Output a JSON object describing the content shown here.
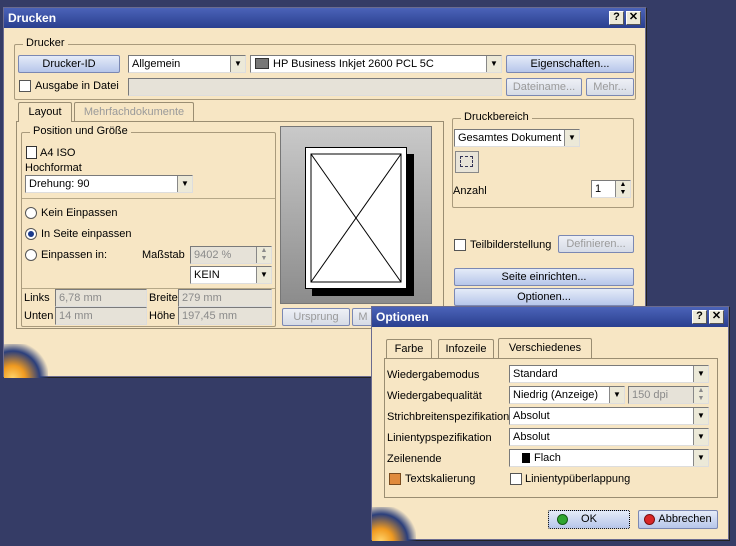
{
  "drucken": {
    "title": "Drucken",
    "help": "?",
    "close": "✕",
    "drucker_group": "Drucker",
    "drucker_id_btn": "Drucker-ID",
    "category": "Allgemein",
    "printer": "HP Business Inkjet 2600 PCL 5C",
    "eigenschaften_btn": "Eigenschaften...",
    "ausgabe_label": "Ausgabe in Datei",
    "dateiname_btn": "Dateiname...",
    "mehr_btn": "Mehr...",
    "tabs": [
      "Layout",
      "Mehrfachdokumente"
    ],
    "position_group": "Position und Größe",
    "format": "A4 ISO",
    "hochformat_label": "Hochformat",
    "rotation": "Drehung: 90",
    "kein_einpassen": "Kein Einpassen",
    "in_seite": "In Seite einpassen",
    "einpassen_in": "Einpassen in:",
    "massstab_label": "Maßstab",
    "massstab_value": "9402 %",
    "kein": "KEIN",
    "links_label": "Links",
    "links_value": "6,78 mm",
    "breite_label": "Breite",
    "breite_value": "279 mm",
    "unten_label": "Unten",
    "unten_value": "14 mm",
    "hoehe_label": "Höhe",
    "hoehe_value": "197,45 mm",
    "ursprung_btn": "Ursprung",
    "m_btn": "M",
    "druckbereich_group": "Druckbereich",
    "druckbereich_value": "Gesamtes Dokument",
    "anzahl_label": "Anzahl",
    "anzahl_value": "1",
    "teilbild_label": "Teilbilderstellung",
    "definieren_btn": "Definieren...",
    "seite_btn": "Seite einrichten...",
    "optionen_btn": "Optionen..."
  },
  "optionen": {
    "title": "Optionen",
    "help": "?",
    "close": "✕",
    "tabs": [
      "Farbe",
      "Infozeile",
      "Verschiedenes"
    ],
    "wiedergabemodus_label": "Wiedergabemodus",
    "wiedergabemodus_value": "Standard",
    "wiedergabequalitaet_label": "Wiedergabequalität",
    "wiedergabequalitaet_value": "Niedrig (Anzeige)",
    "dpi_value": "150  dpi",
    "strichbreiten_label": "Strichbreitenspezifikation",
    "strichbreiten_value": "Absolut",
    "linientyp_label": "Linientypspezifikation",
    "linientyp_value": "Absolut",
    "zeilenende_label": "Zeilenende",
    "zeilenende_value": "Flach",
    "textskalierung_label": "Textskalierung",
    "ueberlappung_label": "Linientypüberlappung",
    "ok_btn": "OK",
    "abbrechen_btn": "Abbrechen"
  }
}
